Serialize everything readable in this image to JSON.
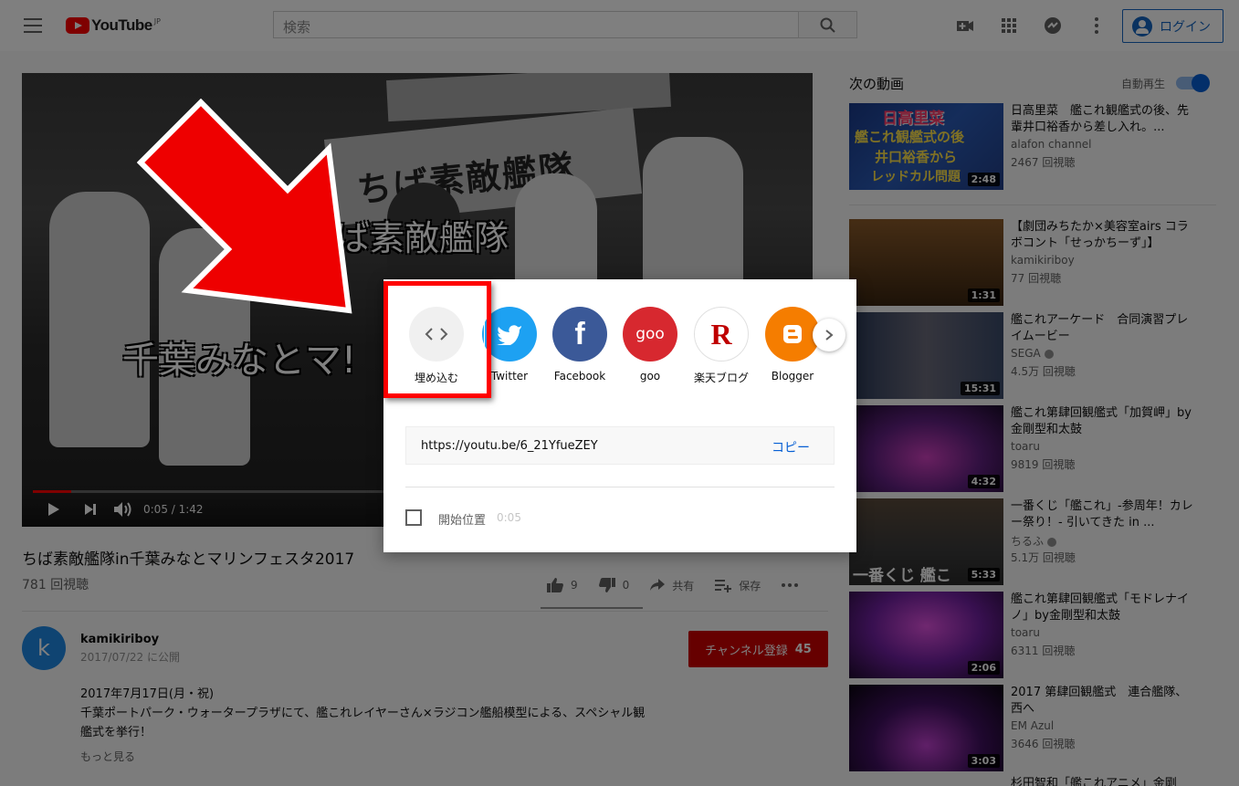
{
  "header": {
    "logo_text": "YouTube",
    "logo_region": "JP",
    "search_placeholder": "検索",
    "login_label": "ログイン"
  },
  "player": {
    "overlay_text_top": "ば素敵艦隊",
    "overlay_text_bottom": "千葉みなとマ!",
    "banner_text": "ちば素敵艦隊",
    "time": "0:05 / 1:42",
    "progress": 0.05
  },
  "video": {
    "title": "ちば素敵艦隊in千葉みなとマリンフェスタ2017",
    "views": "781 回視聴",
    "likes": "9",
    "dislikes": "0",
    "share_label": "共有",
    "save_label": "保存"
  },
  "owner": {
    "avatar_letter": "k",
    "name": "kamikiriboy",
    "published": "2017/07/22 に公開",
    "subscribe_label": "チャンネル登録",
    "subscribers": "45"
  },
  "description": {
    "line1": "2017年7月17日(月・祝)",
    "line2": "千葉ポートパーク・ウォータープラザにて、艦これレイヤーさん×ラジコン艦船模型による、スペシャル観艦式を挙行！",
    "more": "もっと見る"
  },
  "sidebar": {
    "up_next": "次の動画",
    "autoplay": "自動再生",
    "thumb1_text": [
      "日高里菜",
      "艦これ観艦式の後",
      "井口裕香から",
      "レッドカル問題"
    ],
    "thumb7_text": "一番くじ 艦こ",
    "cards": [
      {
        "title": "日高里菜　艦これ観艦式の後、先輩井口裕香から差し入れ。...",
        "channel": "alafon channel",
        "views": "2467 回視聴",
        "duration": "2:48"
      },
      {
        "title": "【劇団みちたか×美容室airs コラボコント「せっかちーず」】",
        "channel": "kamikiriboy",
        "views": "77 回視聴",
        "duration": "1:31"
      },
      {
        "title": "艦これアーケード　合同演習プレイムービー",
        "channel": "SEGA",
        "views": "4.5万 回視聴",
        "duration": "15:31"
      },
      {
        "title": "艦これ第肆回観艦式「加賀岬」by金剛型和太鼓",
        "channel": "toaru",
        "views": "9819 回視聴",
        "duration": "4:32"
      },
      {
        "title": "一番くじ「艦これ」-参周年！カレー祭り！- 引いてきた in ...",
        "channel": "ちるふ",
        "views": "5.1万 回視聴",
        "duration": "5:33"
      },
      {
        "title": "艦これ第肆回観艦式「モドレナイノ」by金剛型和太鼓",
        "channel": "toaru",
        "views": "6311 回視聴",
        "duration": "2:06"
      },
      {
        "title": "2017 第肆回観艦式　連合艦隊、西へ",
        "channel": "EM Azul",
        "views": "3646 回視聴",
        "duration": "3:03"
      }
    ],
    "partial_title": "杉田智和「艦これアニメ」金剛"
  },
  "share_dialog": {
    "targets": [
      {
        "label": "埋め込む",
        "icon": "embed-icon",
        "color": "#f0f0f0"
      },
      {
        "label": "Twitter",
        "icon": "twitter-icon",
        "color": "#1da1f2"
      },
      {
        "label": "Facebook",
        "icon": "facebook-icon",
        "color": "#3b5998",
        "glyph": "f"
      },
      {
        "label": "goo",
        "icon": "goo-icon",
        "color": "#d7282f",
        "glyph": "goo"
      },
      {
        "label": "楽天ブログ",
        "icon": "rakuten-icon",
        "color": "#ffffff",
        "glyph": "R"
      },
      {
        "label": "Blogger",
        "icon": "blogger-icon",
        "color": "#f57d00"
      }
    ],
    "url": "https://youtu.be/6_21YfueZEY",
    "copy_label": "コピー",
    "start_label": "開始位置",
    "start_value": "0:05"
  }
}
